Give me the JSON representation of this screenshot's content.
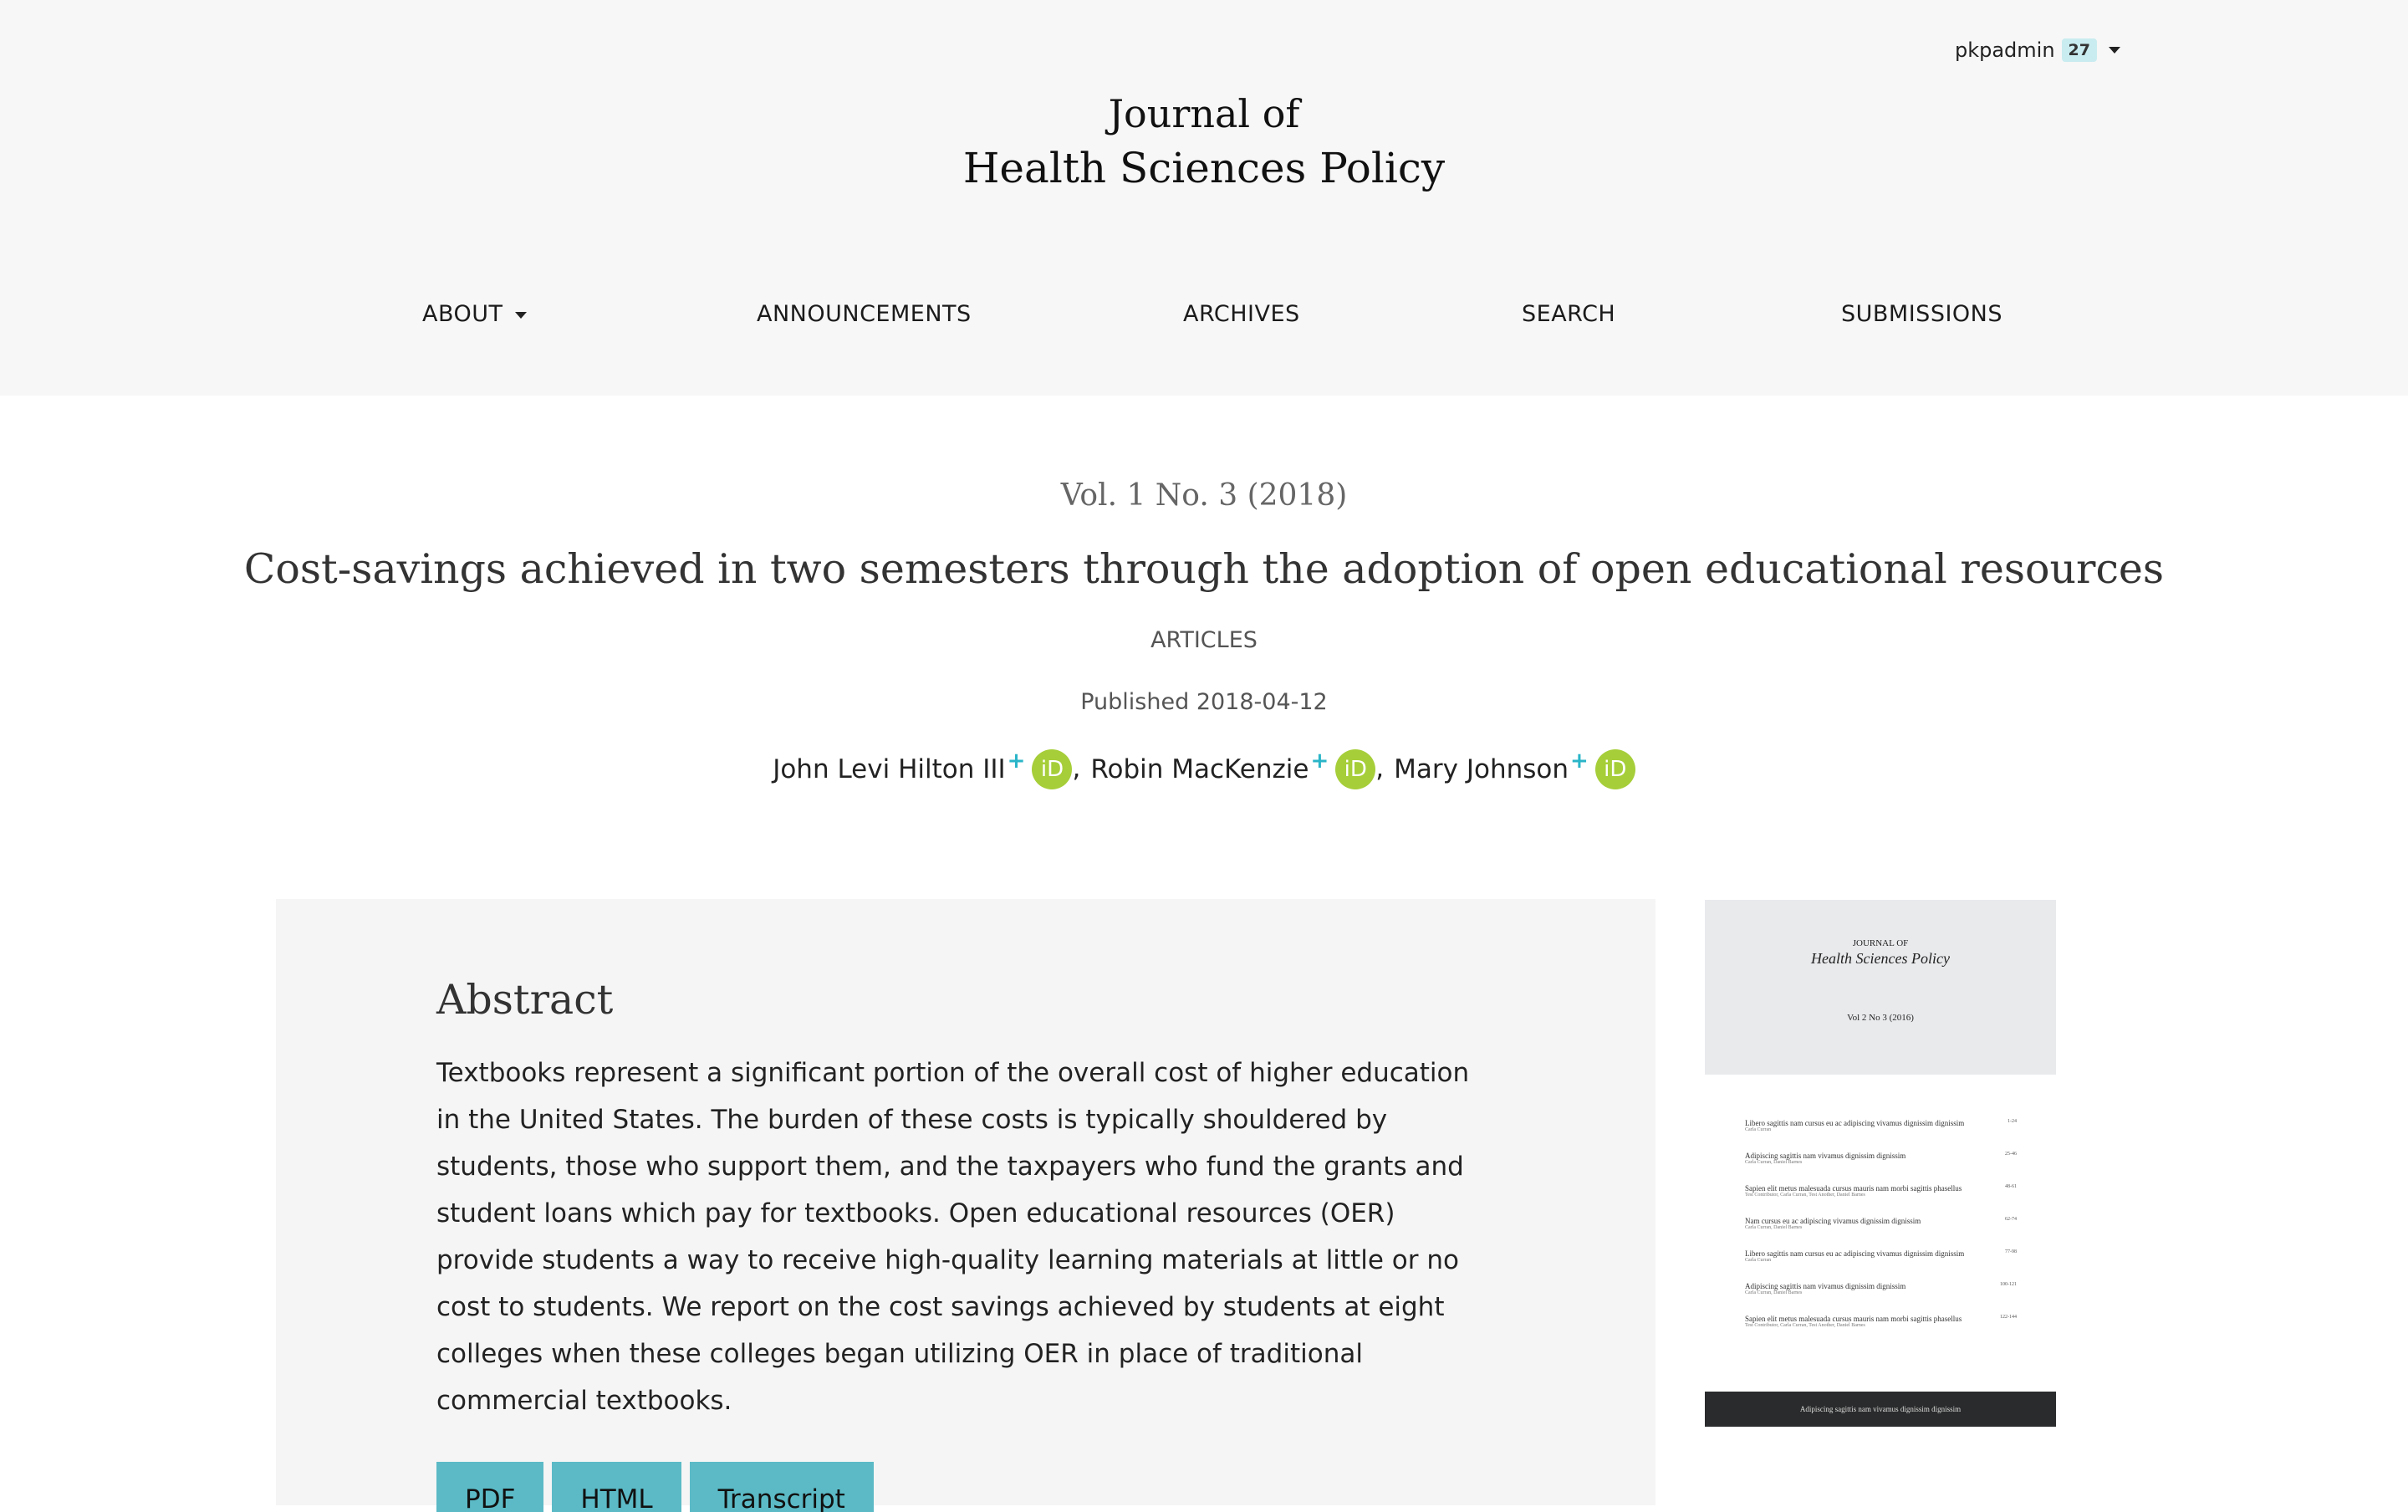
{
  "user": {
    "name": "pkpadmin",
    "notifications": "27"
  },
  "journal": {
    "title_line1": "Journal of",
    "title_line2": "Health Sciences Policy"
  },
  "nav": [
    {
      "label": "ABOUT",
      "has_dropdown": true
    },
    {
      "label": "ANNOUNCEMENTS"
    },
    {
      "label": "ARCHIVES"
    },
    {
      "label": "SEARCH"
    },
    {
      "label": "SUBMISSIONS"
    }
  ],
  "article": {
    "issue": "Vol. 1 No. 3 (2018)",
    "title": "Cost-savings achieved in two semesters through the adoption of open educational resources",
    "section": "ARTICLES",
    "published": "Published 2018-04-12",
    "authors": [
      {
        "name": "John Levi Hilton III",
        "mark": "+"
      },
      {
        "name": "Robin MacKenzie",
        "mark": "+"
      },
      {
        "name": "Mary Johnson",
        "mark": "+"
      }
    ],
    "orcid_label": "iD",
    "author_separator": ","
  },
  "abstract": {
    "heading": "Abstract",
    "text": "Textbooks represent a significant portion of the overall cost of higher education in the United States. The burden of these costs is typically shouldered by students, those who support them, and the taxpayers who fund the grants and student loans which pay for textbooks. Open educational resources (OER) provide students a way to receive high-quality learning materials at little or no cost to students. We report on the cost savings achieved by students at eight colleges when these colleges began utilizing OER in place of traditional commercial textbooks."
  },
  "galleys": [
    "PDF",
    "HTML",
    "Transcript"
  ],
  "cover": {
    "small_title": "JOURNAL OF",
    "big_title": "Health Sciences Policy",
    "volume": "Vol 2 No 3 (2016)",
    "toc": [
      {
        "title": "Libero sagittis nam cursus eu ac adipiscing vivamus dignissim dignissim",
        "authors": "Carla Curran",
        "pages": "1-24"
      },
      {
        "title": "Adipiscing sagittis nam vivamus dignissim dignissim",
        "authors": "Carla Curran, Daniel Barnes",
        "pages": "25-46"
      },
      {
        "title": "Sapien elit metus malesuada cursus mauris nam morbi sagittis phasellus",
        "authors": "Test Contributor, Carla Curran, Test Another, Daniel Barnes",
        "pages": "48-61"
      },
      {
        "title": "Nam cursus eu ac adipiscing vivamus dignissim dignissim",
        "authors": "Carla Curran, Daniel Barnes",
        "pages": "62-74"
      },
      {
        "title": "Libero sagittis nam cursus eu ac adipiscing vivamus dignissim dignissim",
        "authors": "Carla Curran",
        "pages": "77-98"
      },
      {
        "title": "Adipiscing sagittis nam vivamus dignissim dignissim",
        "authors": "Carla Curran, Daniel Barnes",
        "pages": "100-121"
      },
      {
        "title": "Sapien elit metus malesuada cursus mauris nam morbi sagittis phasellus",
        "authors": "Test Contributor, Carla Curran, Test Another, Daniel Barnes",
        "pages": "122-144"
      }
    ],
    "footer": "Adipiscing sagittis nam vivamus dignissim dignissim"
  },
  "colors": {
    "header_bg": "#f7f7f7",
    "galley_button": "#5bbac6",
    "orcid": "#a6ce39",
    "badge": "#c9ecf0"
  }
}
